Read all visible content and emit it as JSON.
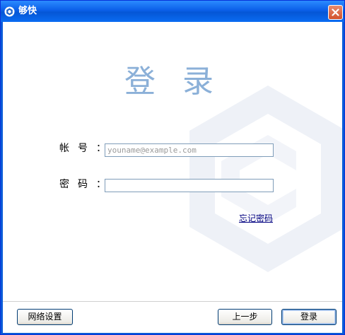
{
  "window": {
    "title": "够快",
    "icon": "hexagon-app-icon",
    "close_icon": "close-icon"
  },
  "login": {
    "heading": "登录",
    "account_label": "帐号",
    "password_label": "密码",
    "colon": "：",
    "account_placeholder": "youname@example.com",
    "account_value": "",
    "password_value": "",
    "forgot_password": "忘记密码"
  },
  "footer": {
    "network_settings": "网络设置",
    "back": "上一步",
    "login": "登录"
  },
  "colors": {
    "titlebar": "#0b5fe8",
    "close_button": "#d2512c",
    "heading": "#8bb0d8",
    "link": "#000080",
    "watermark": "#eef1f7"
  }
}
